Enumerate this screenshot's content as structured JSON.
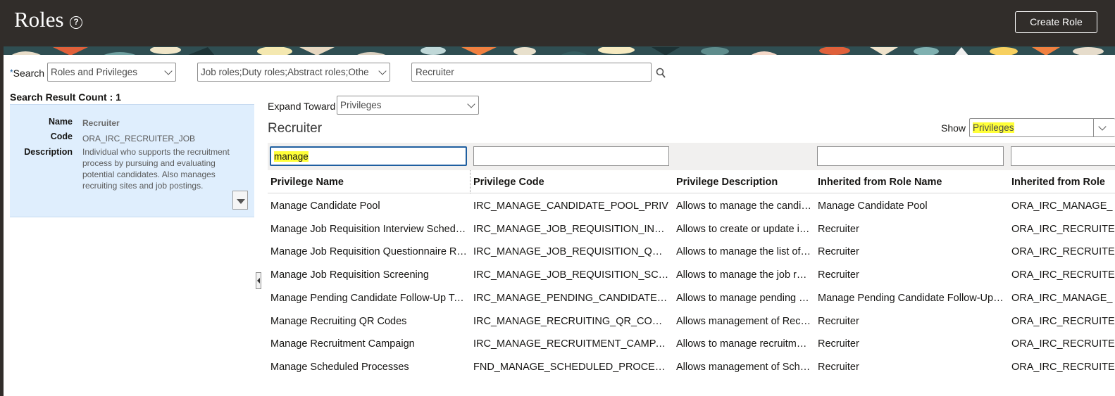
{
  "header": {
    "title": "Roles",
    "help_icon": "?",
    "create_role_label": "Create Role"
  },
  "search": {
    "label": "Search",
    "required_marker": "*",
    "scope_value": "Roles and Privileges",
    "role_types_value": "Job roles;Duty roles;Abstract roles;Othe",
    "keyword_value": "Recruiter"
  },
  "results": {
    "count_label": "Search Result Count : 1",
    "item": {
      "name_label": "Name",
      "name_value": "Recruiter",
      "code_label": "Code",
      "code_value": "ORA_IRC_RECRUITER_JOB",
      "description_label": "Description",
      "description_value": "Individual who supports the recruitment process by pursuing and evaluating potential candidates. Also manages recruiting sites and job postings."
    }
  },
  "hierarchy": {
    "expand_toward_label": "Expand Toward",
    "expand_toward_value": "Privileges",
    "section_title": "Recruiter",
    "show_label": "Show",
    "show_value": "Privileges",
    "filter_privilege_name": "manage",
    "columns": [
      "Privilege Name",
      "Privilege Code",
      "Privilege Description",
      "Inherited from Role Name",
      "Inherited from Role"
    ],
    "rows": [
      [
        "Manage Candidate Pool",
        "IRC_MANAGE_CANDIDATE_POOL_PRIV",
        "Allows to manage the candi…",
        "Manage Candidate Pool",
        "ORA_IRC_MANAGE_"
      ],
      [
        "Manage Job Requisition Interview Schedule",
        "IRC_MANAGE_JOB_REQUISITION_INTER…",
        "Allows to create or update i…",
        "Recruiter",
        "ORA_IRC_RECRUITE"
      ],
      [
        "Manage Job Requisition Questionnaire Re…",
        "IRC_MANAGE_JOB_REQUISITION_QUES…",
        "Allows to manage the list of …",
        "Recruiter",
        "ORA_IRC_RECRUITE"
      ],
      [
        "Manage Job Requisition Screening",
        "IRC_MANAGE_JOB_REQUISITION_SCRE…",
        "Allows to manage the job re…",
        "Recruiter",
        "ORA_IRC_RECRUITE"
      ],
      [
        "Manage Pending Candidate Follow-Up Task",
        "IRC_MANAGE_PENDING_CANDIDATE_F…",
        "Allows to manage pending c…",
        "Manage Pending Candidate Follow-Up T…",
        "ORA_IRC_MANAGE_"
      ],
      [
        "Manage Recruiting QR Codes",
        "IRC_MANAGE_RECRUITING_QR_CODES…",
        "Allows management of Recr…",
        "Recruiter",
        "ORA_IRC_RECRUITE"
      ],
      [
        "Manage Recruitment Campaign",
        "IRC_MANAGE_RECRUITMENT_CAMPAIG…",
        "Allows to manage recruitme…",
        "Recruiter",
        "ORA_IRC_RECRUITE"
      ],
      [
        "Manage Scheduled Processes",
        "FND_MANAGE_SCHEDULED_PROCESS…",
        "Allows management of Sche…",
        "Recruiter",
        "ORA_IRC_RECRUITE"
      ]
    ]
  },
  "icons": {
    "help": "help-icon",
    "search": "search-icon",
    "chevron": "chevron-down-icon",
    "panel_expand": "expand-detail-icon",
    "splitter": "collapse-panel-icon"
  },
  "colors": {
    "header_bg": "#312d2a",
    "panel_bg": "#dfeefd",
    "highlight": "#ffff39",
    "focus": "#1f5fa0"
  }
}
